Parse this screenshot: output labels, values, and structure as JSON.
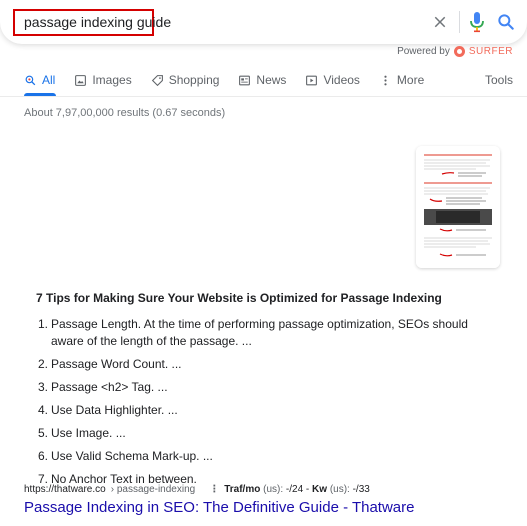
{
  "search": {
    "query": "passage indexing guide",
    "powered_by": "Powered by",
    "surfer": "SURFER"
  },
  "tabs": [
    {
      "label": "All",
      "icon": "search-icon",
      "active": true
    },
    {
      "label": "Images",
      "icon": "image-icon"
    },
    {
      "label": "Shopping",
      "icon": "tag-icon"
    },
    {
      "label": "News",
      "icon": "news-icon"
    },
    {
      "label": "Videos",
      "icon": "video-icon"
    },
    {
      "label": "More",
      "icon": "more-vert-icon"
    }
  ],
  "tools_label": "Tools",
  "stats": "About 7,97,00,000 results (0.67 seconds)",
  "snippet": {
    "title": "7 Tips for Making Sure Your Website is Optimized for Passage Indexing",
    "items": [
      {
        "num": "1.",
        "text": "Passage Length. At the time of performing passage optimization, SEOs should aware of the length of the passage. ..."
      },
      {
        "num": "2.",
        "text": "Passage Word Count. ..."
      },
      {
        "num": "3.",
        "text": "Passage <h2> Tag. ..."
      },
      {
        "num": "4.",
        "text": "Use Data Highlighter. ..."
      },
      {
        "num": "5.",
        "text": "Use Image. ..."
      },
      {
        "num": "6.",
        "text": "Use Valid Schema Mark-up. ..."
      },
      {
        "num": "7.",
        "text": "No Anchor Text in between."
      }
    ]
  },
  "result": {
    "domain": "https://thatware.co",
    "path": "› passage-indexing",
    "traf_label": "Traf/mo",
    "traf_region": "(us):",
    "traf_value": "-/24",
    "kw_label": "Kw",
    "kw_region": "(us):",
    "kw_value": "-/33",
    "title": "Passage Indexing in SEO: The Definitive Guide - Thatware"
  },
  "colors": {
    "accent": "#1a73e8",
    "link": "#1a0dab",
    "highlight_border": "#d40000",
    "surfer": "#f26b5b"
  }
}
